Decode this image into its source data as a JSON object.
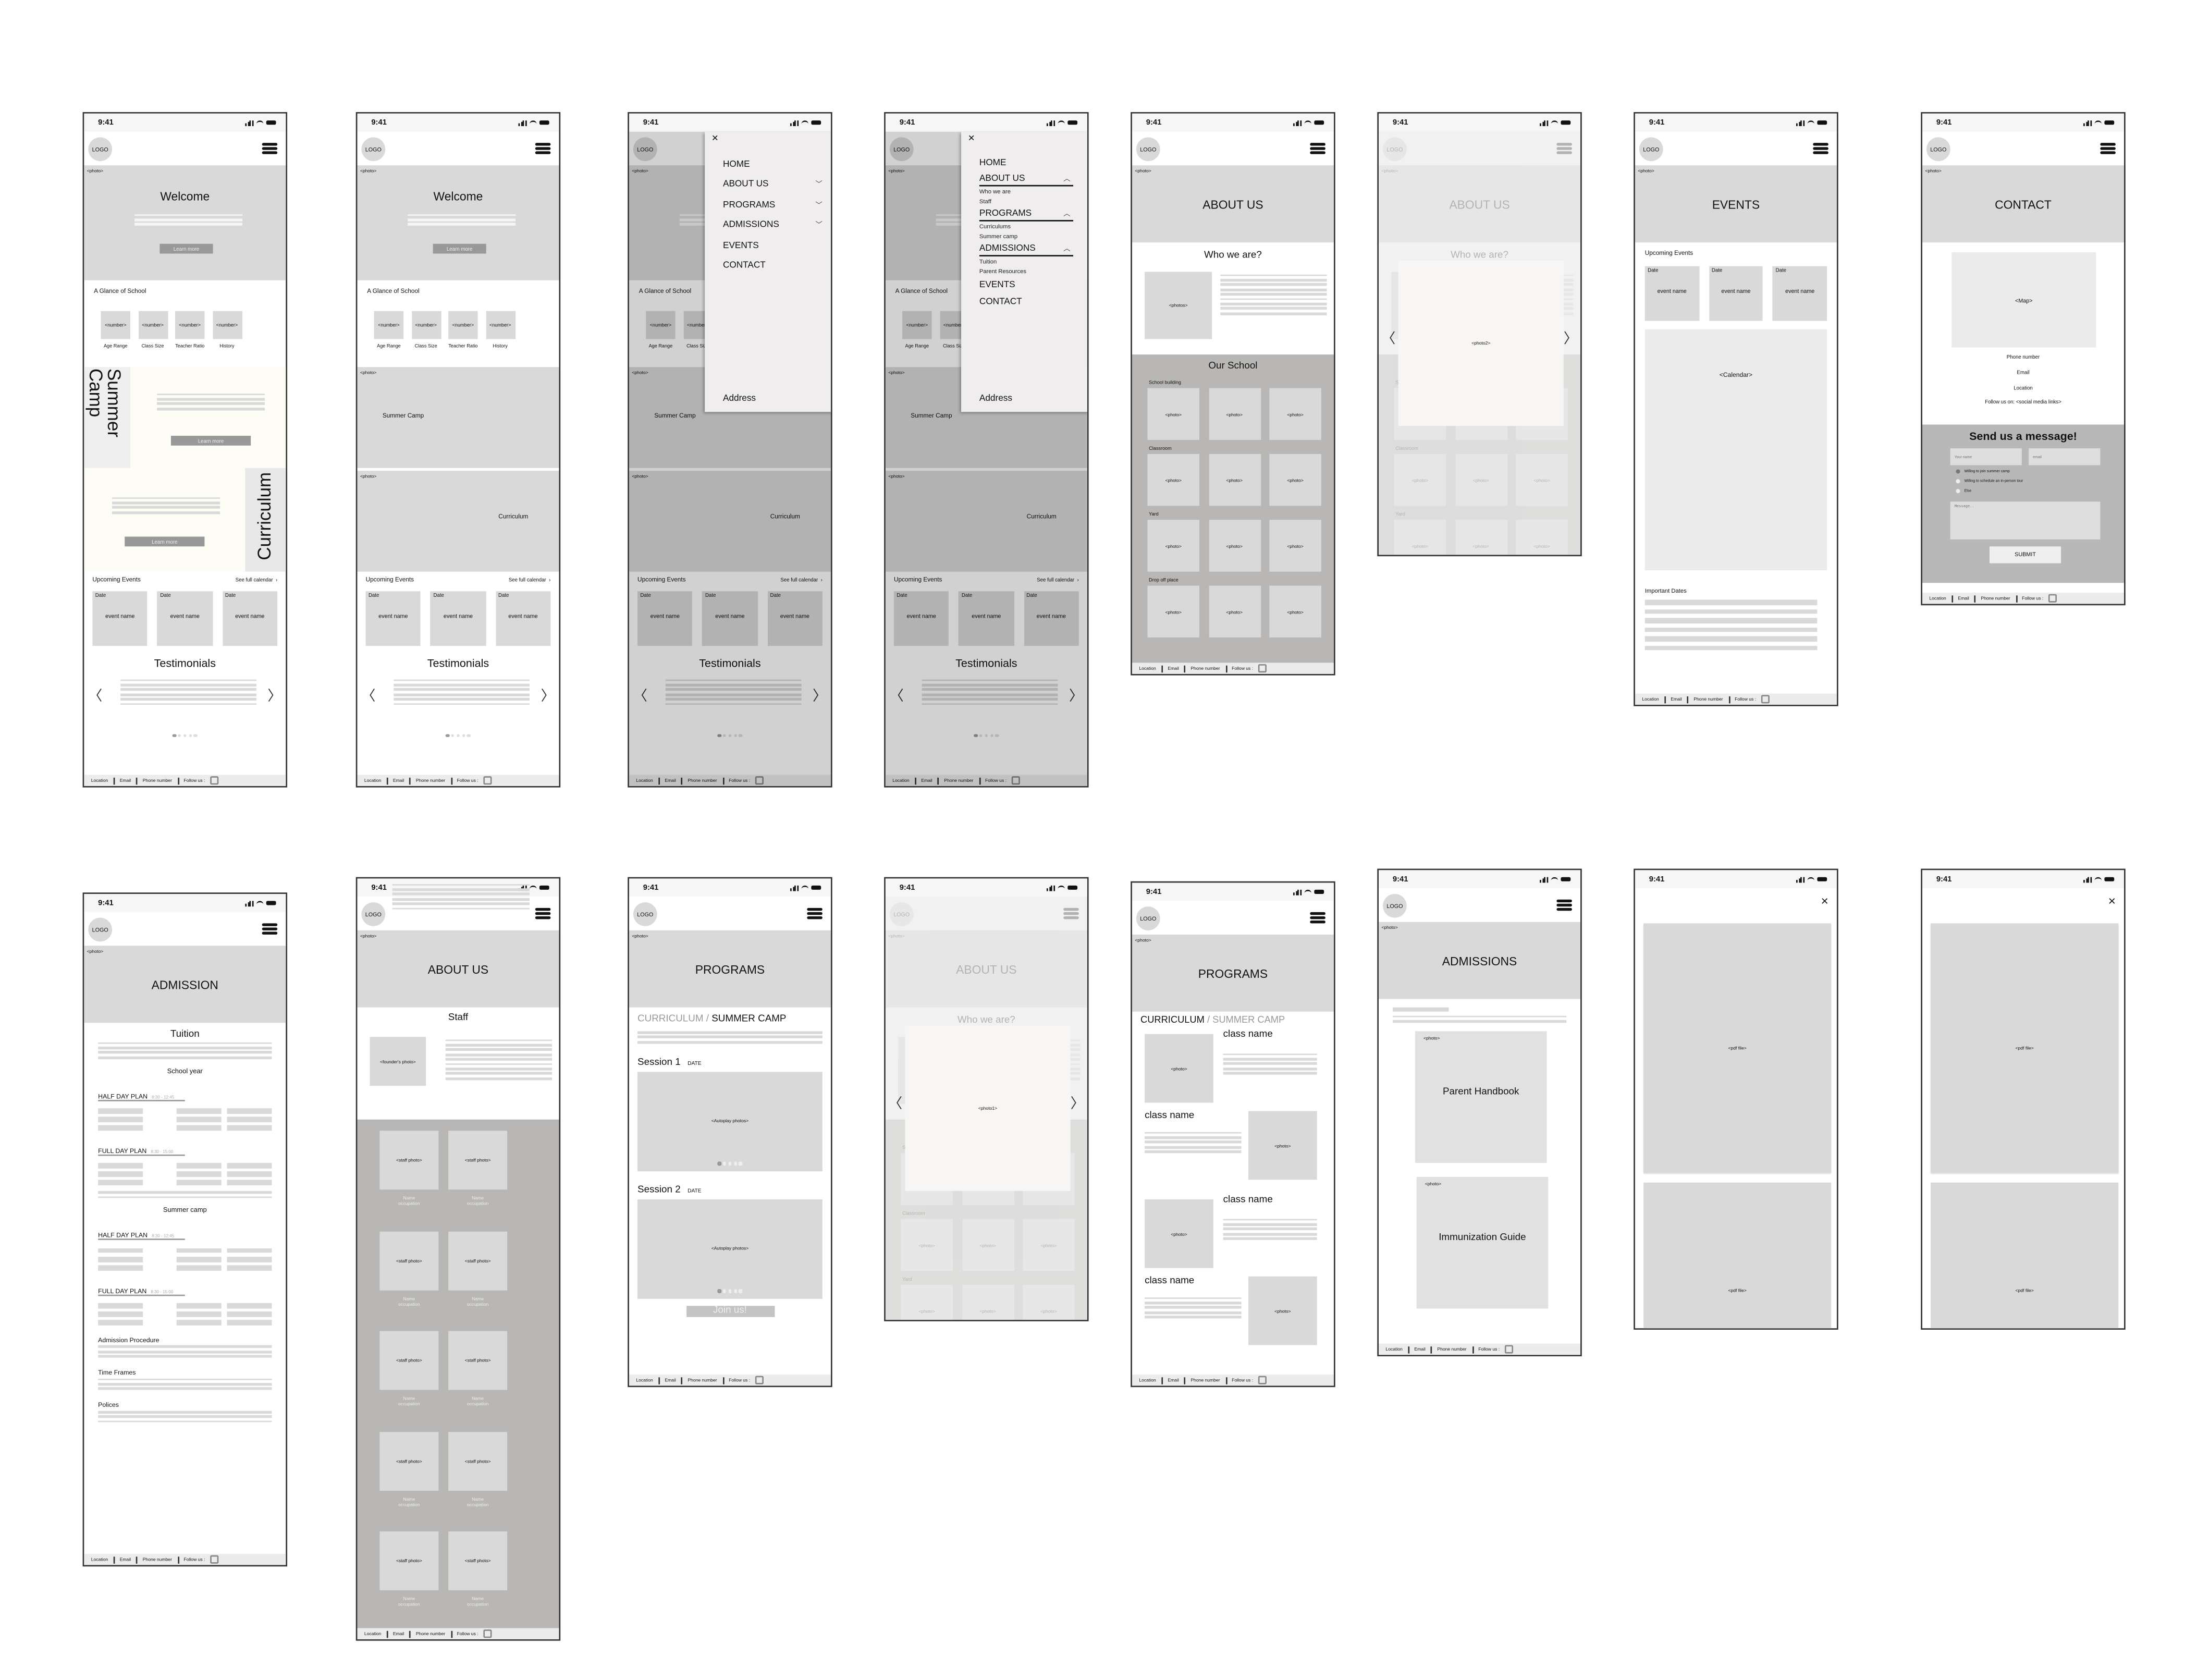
{
  "common": {
    "time": "9:41",
    "logo": "LOGO",
    "photo_tag": "<photo>",
    "footer": {
      "location": "Location",
      "email": "Email",
      "phone": "Phone number",
      "follow": "Follow us :"
    }
  },
  "home": {
    "welcome": "Welcome",
    "learn_more": "Learn more",
    "glance_title": "A Glance of School",
    "stat_value": "<number>",
    "stats": [
      "Age Range",
      "Class Size",
      "Teacher Ratio",
      "History"
    ],
    "summer_camp": "Summer Camp",
    "curriculum": "Curriculum",
    "events_title": "Upcoming Events",
    "see_calendar": "See full calendar",
    "event_date": "Date",
    "event_name": "event name",
    "testimonials": "Testimonials"
  },
  "menu": {
    "close_icon": "close-icon",
    "items": [
      "HOME",
      "ABOUT US",
      "PROGRAMS",
      "ADMISSIONS",
      "EVENTS",
      "CONTACT"
    ],
    "about_sub": [
      "Who we are",
      "Staff"
    ],
    "programs_sub": [
      "Curriculums",
      "Summer camp"
    ],
    "admissions_sub": [
      "Tuition",
      "Parent Resources"
    ],
    "address": "Address"
  },
  "about": {
    "title": "ABOUT US",
    "who": "Who we are?",
    "photos": "<photos>",
    "our_school": "Our School",
    "categories": [
      "School building",
      "Classroom",
      "Yard",
      "Drop off place"
    ],
    "photo": "<photo>",
    "lightbox_photo2": "<photo2>",
    "lightbox_photo1": "<photo1>"
  },
  "events": {
    "title": "EVENTS",
    "upcoming": "Upcoming Events",
    "calendar": "<Calendar>",
    "important": "Important Dates"
  },
  "contact": {
    "title": "CONTACT",
    "map": "<Map>",
    "phone": "Phone number",
    "email": "Email",
    "location": "Location",
    "follow": "Follow us on: <social media links>",
    "send": "Send us a message!",
    "name_placeholder": "Your name",
    "email_placeholder": "email",
    "options": [
      "Willing to join summer camp",
      "Willing to schedule an in-person tour",
      "Else"
    ],
    "selected_option": 0,
    "message_placeholder": "Message..",
    "submit": "SUBMIT"
  },
  "admission": {
    "title": "ADMISSION",
    "tuition": "Tuition",
    "school_year": "School year",
    "summer_camp": "Summer camp",
    "half_day": "HALF DAY PLAN",
    "half_time": "8:30 - 12:45",
    "full_day": "FULL DAY PLAN",
    "full_time": "8:30 - 15:00",
    "procedure": "Admission Procedure",
    "time_frames": "Time Frames",
    "polices": "Polices"
  },
  "staff": {
    "title": "ABOUT US",
    "heading": "Staff",
    "founder": "<founder's photo>",
    "staff_photo": "<staff photo>",
    "name": "Name",
    "occupation": "occupation"
  },
  "programs": {
    "title": "PROGRAMS",
    "curriculum": "CURRICULUM",
    "slash": " / ",
    "summer": "SUMMER CAMP",
    "session1": "Session 1",
    "session2": "Session 2",
    "date": "DATE",
    "autoplay": "<Autoplay photos>",
    "join": "Join us!",
    "class_name": "class name"
  },
  "admissions": {
    "title": "ADMISSIONS",
    "handbook": "Parent Handbook",
    "immunization": "Immunization Guide"
  },
  "pdf": {
    "label": "<pdf file>"
  }
}
